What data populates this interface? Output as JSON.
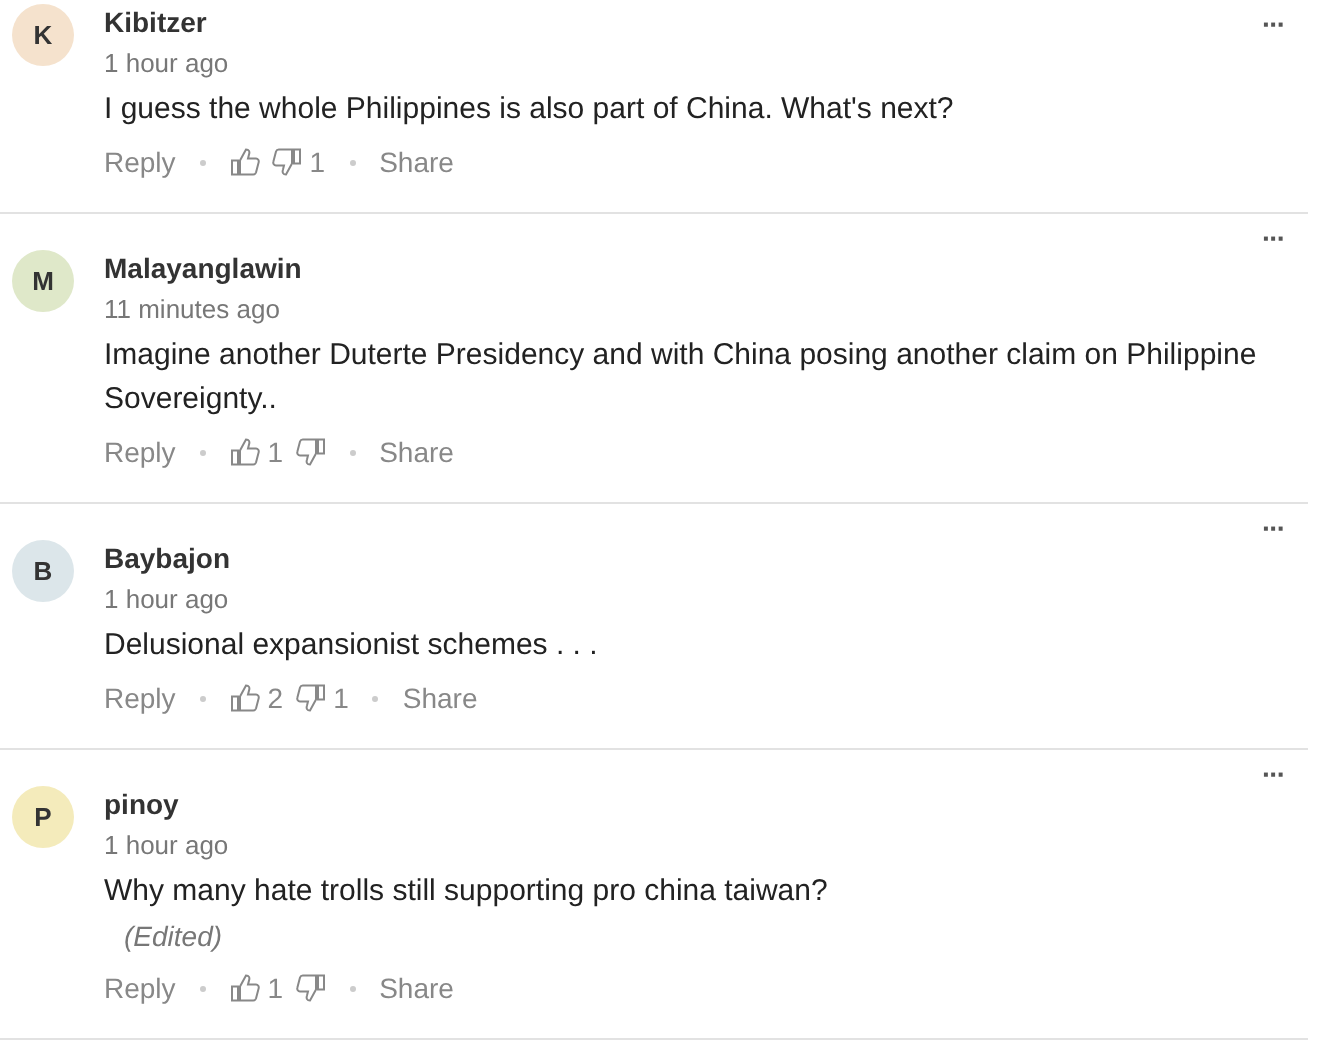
{
  "comments": [
    {
      "initial": "K",
      "color": "#f5e2cd",
      "author": "Kibitzer",
      "time": "1 hour ago",
      "text": "I guess the whole Philippines is also part of China. What's next?",
      "reply": "Reply",
      "dislikes": "1",
      "share": "Share",
      "more": "···"
    },
    {
      "initial": "M",
      "color": "#dfe8c9",
      "author": "Malayanglawin",
      "time": "11 minutes ago",
      "text": "Imagine another Duterte Presidency and with China posing another claim on Philippine Sovereignty..",
      "reply": "Reply",
      "likes": "1",
      "share": "Share",
      "more": "···"
    },
    {
      "initial": "B",
      "color": "#dce6ea",
      "author": "Baybajon",
      "time": "1 hour ago",
      "text": "Delusional expansionist schemes . . .",
      "reply": "Reply",
      "likes": "2",
      "dislikes": "1",
      "share": "Share",
      "more": "···"
    },
    {
      "initial": "P",
      "color": "#f4ebbb",
      "author": "pinoy",
      "time": "1 hour ago",
      "text": "Why many hate trolls still supporting pro china taiwan?",
      "edited": "(Edited)",
      "reply": "Reply",
      "likes": "1",
      "share": "Share",
      "more": "···"
    }
  ]
}
